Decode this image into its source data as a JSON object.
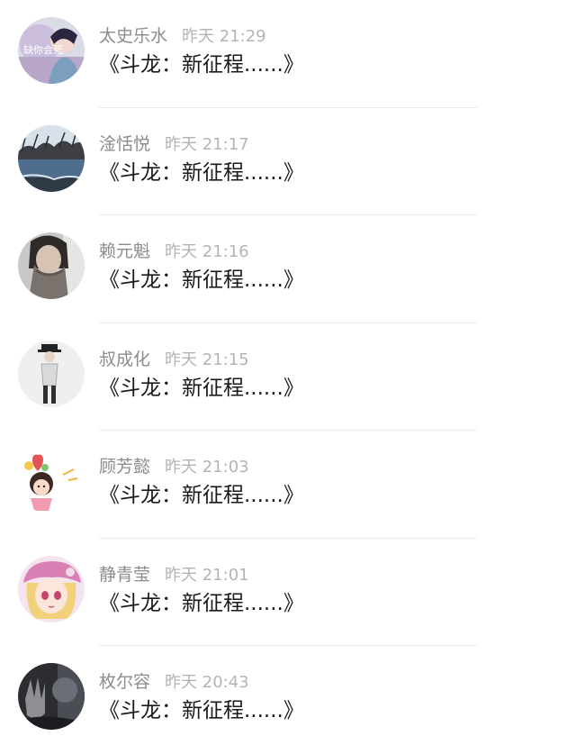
{
  "comments": [
    {
      "name": "太史乐水",
      "time": "昨天 21:29",
      "message": "《斗龙：新征程......》",
      "avatar_icon": "user-avatar-portrait",
      "avatar_text": "缺你会死"
    },
    {
      "name": "淦恬悦",
      "time": "昨天 21:17",
      "message": "《斗龙：新征程......》",
      "avatar_icon": "user-avatar-landscape"
    },
    {
      "name": "赖元魁",
      "time": "昨天 21:16",
      "message": "《斗龙：新征程......》",
      "avatar_icon": "user-avatar-scarf-person"
    },
    {
      "name": "叔成化",
      "time": "昨天 21:15",
      "message": "《斗龙：新征程......》",
      "avatar_icon": "user-avatar-hat-person"
    },
    {
      "name": "顾芳懿",
      "time": "昨天 21:03",
      "message": "《斗龙：新征程......》",
      "avatar_icon": "user-avatar-cartoon-balloon"
    },
    {
      "name": "静青莹",
      "time": "昨天 21:01",
      "message": "《斗龙：新征程......》",
      "avatar_icon": "user-avatar-anime-girl"
    },
    {
      "name": "枚尔容",
      "time": "昨天 20:43",
      "message": "《斗龙：新征程......》",
      "avatar_icon": "user-avatar-dark-hand"
    }
  ]
}
